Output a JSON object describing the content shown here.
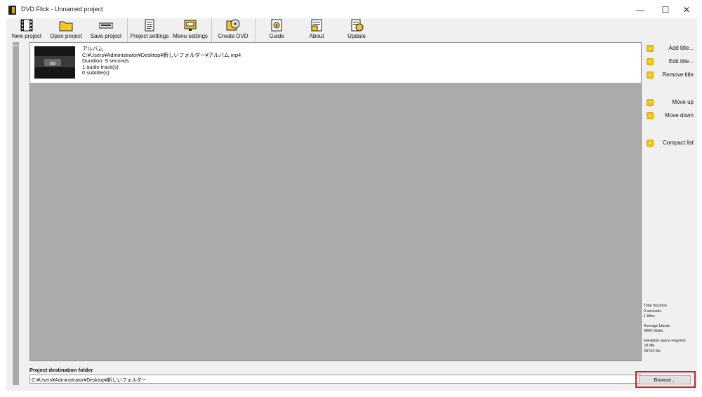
{
  "window": {
    "title": "DVD Flick - Unnamed project",
    "minimize_glyph": "—",
    "maximize_glyph": "☐",
    "close_glyph": "✕"
  },
  "toolbar": {
    "new_project": "New project",
    "open_project": "Open project",
    "save_project": "Save project",
    "project_settings": "Project settings",
    "menu_settings": "Menu settings",
    "create_dvd": "Create DVD",
    "guide": "Guide",
    "about": "About",
    "update": "Update"
  },
  "left_strip": {
    "label": "0%"
  },
  "titles": [
    {
      "name": "アルバム",
      "path": "C:¥Users¥Administrator¥Desktop¥新しいフォルダー¥アルバム.mp4",
      "duration": "Duration: 9 seconds",
      "audio": "1 audio track(s)",
      "subtitles": "0 subtitle(s)"
    }
  ],
  "side_actions": {
    "add_title": "Add title...",
    "edit_title": "Edit title...",
    "remove_title": "Remove title",
    "move_up": "Move up",
    "move_down": "Move down",
    "compact_list": "Compact list"
  },
  "stats": {
    "total_duration_label": "Total duration",
    "total_duration_value": "9 seconds",
    "titles_count": "1 titles",
    "avg_bitrate_label": "Average bitrate",
    "avg_bitrate_value": "9000 Kbit/s",
    "hdd_label": "Harddisk space required",
    "hdd_mb": "28 Mb",
    "hdd_kb": "28743 Kb"
  },
  "destination": {
    "label": "Project destination folder",
    "value": "C:¥Users¥Administrator¥Desktop¥新しいフォルダー",
    "browse": "Browse..."
  },
  "colors": {
    "accent_icon": "#f5c400",
    "list_background": "#ababab",
    "highlight": "#d02020"
  }
}
